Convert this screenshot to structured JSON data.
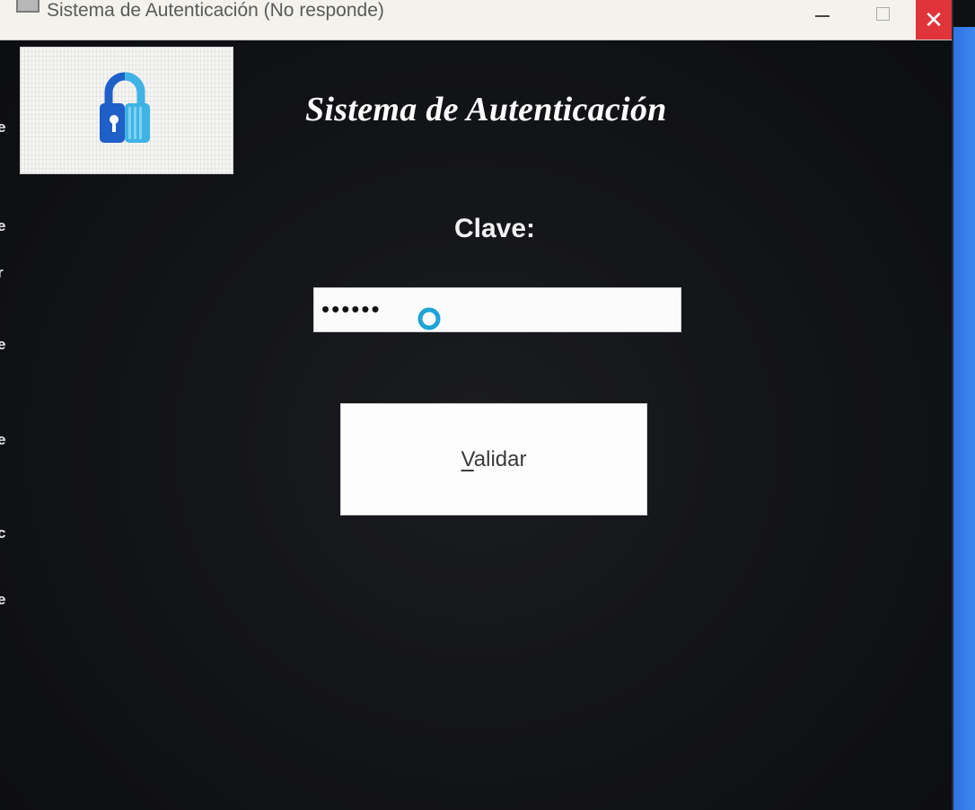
{
  "window": {
    "title": "Sistema de Autenticación (No responde)",
    "close_glyph": "✕"
  },
  "app": {
    "heading": "Sistema de Autenticación",
    "password_label": "Clave:",
    "password_value": "••••••",
    "validate_button": {
      "mnemonic": "V",
      "rest": "alidar"
    },
    "logo_icon": "lock-icon"
  },
  "background_edge_chars": [
    "e",
    "e",
    "r",
    "e",
    "e",
    "c",
    "e"
  ],
  "colors": {
    "close_button": "#e0343a",
    "lock_dark_blue": "#1f5fc8",
    "lock_light_blue": "#3fb3e6",
    "cursor_ring": "#1ea3d8",
    "desktop_blue": "#2a6fe0"
  },
  "cursor": "busy-ring-icon"
}
